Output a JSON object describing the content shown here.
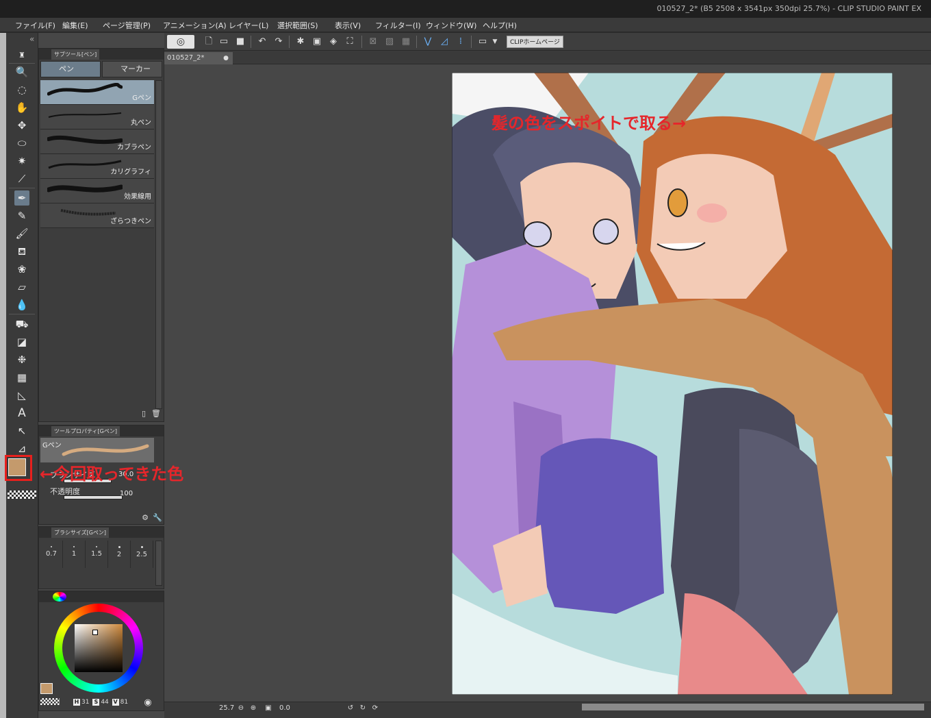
{
  "window": {
    "title": "010527_2* (B5 2508 x 3541px 350dpi 25.7%)  - CLIP STUDIO PAINT EX"
  },
  "menu": [
    "ファイル(F)",
    "編集(E)",
    "ページ管理(P)",
    "アニメーション(A)",
    "レイヤー(L)",
    "選択範囲(S)",
    "表示(V)",
    "フィルター(I)",
    "ウィンドウ(W)",
    "ヘルプ(H)"
  ],
  "toolbar": {
    "home_label": "CLIPホームページ"
  },
  "subtool_panel": {
    "header": "サブツール[ペン]",
    "tabs": [
      "ペン",
      "マーカー"
    ],
    "brushes": [
      "Gペン",
      "丸ペン",
      "カブラペン",
      "カリグラフィ",
      "効果線用",
      "ざらつきペン"
    ]
  },
  "tool_property": {
    "header": "ツールプロパティ[Gペン]",
    "brush_name": "Gペン",
    "size_label": "ブラシサイズ",
    "size_value": "30.0",
    "opacity_label": "不透明度",
    "opacity_value": "100"
  },
  "brush_size_panel": {
    "header": "ブラシサイズ[Gペン]",
    "sizes": [
      "0.7",
      "1",
      "1.5",
      "2",
      "2.5"
    ]
  },
  "color_panel": {
    "h": "31",
    "s": "44",
    "v": "81",
    "h_label": "H",
    "s_label": "S",
    "v_label": "V",
    "current_color": "#c49a6c"
  },
  "document_tab": "010527_2*",
  "annotations": {
    "hair_pick": "髪の色をスポイトで取る→",
    "color_picked": "←今回取ってきた色"
  },
  "status": {
    "zoom": "25.7",
    "angle": "0.0"
  },
  "colors": {
    "accent": "#e5262b",
    "selected": "#6c7d8b"
  }
}
